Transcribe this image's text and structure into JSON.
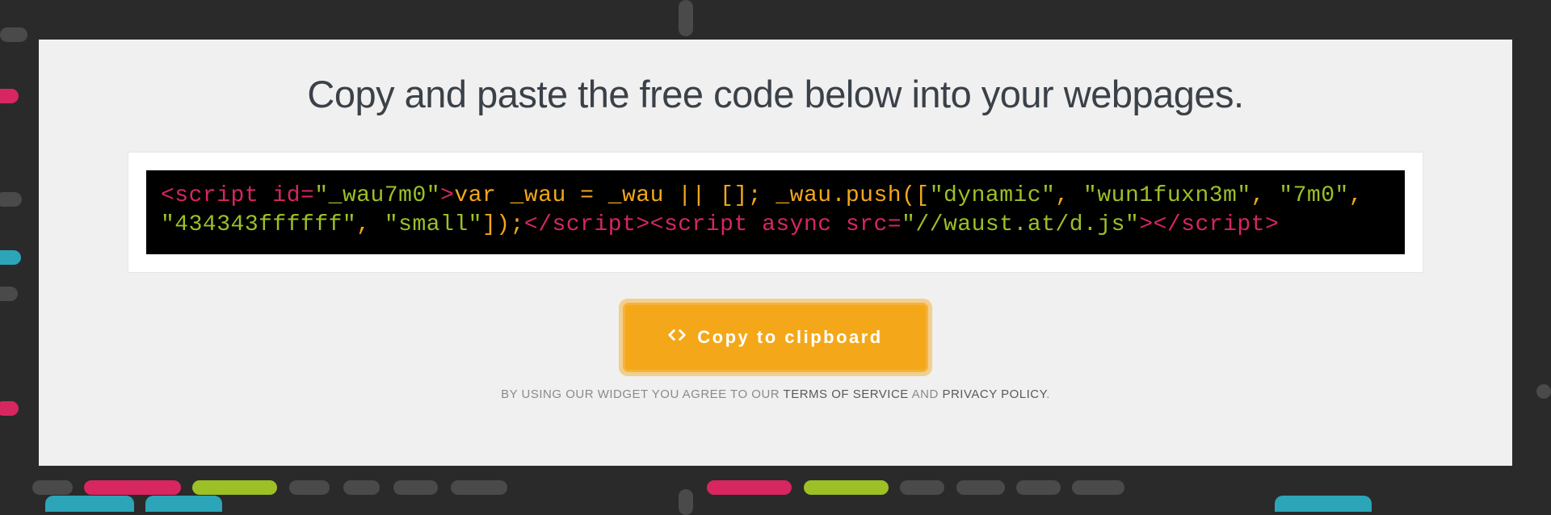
{
  "heading": "Copy and paste the free code below into your webpages.",
  "code": {
    "open1": "<script id=",
    "attr_id": "\"_wau7m0\"",
    "close_open": ">",
    "js1": "var _wau = _wau || []; _wau.push([",
    "str1": "\"dynamic\"",
    "c1": ", ",
    "str2": "\"wun1fuxn3m\"",
    "c2": ", ",
    "str3": "\"7m0\"",
    "c3": ", ",
    "str4": "\"434343ffffff\"",
    "c4": ", ",
    "str5": "\"small\"",
    "js2": "]);",
    "close1": "</scr",
    "close1b": "ipt>",
    "open2": "<script async src=",
    "attr_src": "\"//waust.at/d.js\"",
    "close_open2": ">",
    "close2": "</scr",
    "close2b": "ipt>"
  },
  "button_label": "Copy to clipboard",
  "disclaimer": {
    "prefix": "BY USING OUR WIDGET YOU AGREE TO OUR ",
    "tos": "TERMS OF SERVICE",
    "mid": " AND ",
    "privacy": "PRIVACY POLICY",
    "suffix": "."
  }
}
